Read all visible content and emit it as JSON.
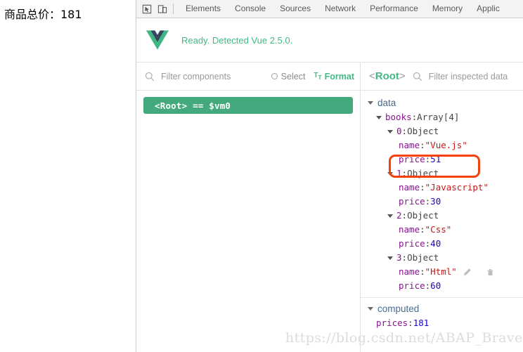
{
  "page": {
    "total_label": "商品总价：181"
  },
  "devtools": {
    "toolbar_icons": [
      "inspect-element-icon",
      "device-toolbar-icon"
    ],
    "tabs": [
      {
        "label": "Elements"
      },
      {
        "label": "Console"
      },
      {
        "label": "Sources"
      },
      {
        "label": "Network"
      },
      {
        "label": "Performance"
      },
      {
        "label": "Memory"
      },
      {
        "label": "Applic"
      }
    ],
    "banner": {
      "logo": "vue-logo",
      "status_text": "Ready. Detected Vue 2.5.0."
    },
    "tree_pane": {
      "filter_placeholder": "Filter components",
      "filter_value": "",
      "select_label": "Select",
      "format_label": "Format",
      "format_icon": "text-format-icon",
      "selected_node": "<Root> == $vm0"
    },
    "data_pane": {
      "root_tag_open": "<",
      "root_tag_name": "Root",
      "root_tag_close": ">",
      "filter_placeholder": "Filter inspected data",
      "filter_value": "",
      "sections": [
        {
          "name": "data",
          "rows": [
            {
              "indent": 1,
              "caret": true,
              "key": "books",
              "sep": ": ",
              "value": "Array[4]",
              "value_kind": "type"
            },
            {
              "indent": 2,
              "caret": true,
              "key": "0",
              "sep": ": ",
              "value": "Object",
              "value_kind": "type"
            },
            {
              "indent": 3,
              "caret": false,
              "key": "name",
              "sep": ": ",
              "value": "\"Vue.js\"",
              "value_kind": "string"
            },
            {
              "indent": 3,
              "caret": false,
              "key": "price",
              "sep": ": ",
              "value": "51",
              "value_kind": "number",
              "highlighted": true
            },
            {
              "indent": 2,
              "caret": true,
              "key": "1",
              "sep": ": ",
              "value": "Object",
              "value_kind": "type"
            },
            {
              "indent": 3,
              "caret": false,
              "key": "name",
              "sep": ": ",
              "value": "\"Javascript\"",
              "value_kind": "string"
            },
            {
              "indent": 3,
              "caret": false,
              "key": "price",
              "sep": ": ",
              "value": "30",
              "value_kind": "number"
            },
            {
              "indent": 2,
              "caret": true,
              "key": "2",
              "sep": ": ",
              "value": "Object",
              "value_kind": "type"
            },
            {
              "indent": 3,
              "caret": false,
              "key": "name",
              "sep": ": ",
              "value": "\"Css\"",
              "value_kind": "string"
            },
            {
              "indent": 3,
              "caret": false,
              "key": "price",
              "sep": ": ",
              "value": "40",
              "value_kind": "number"
            },
            {
              "indent": 2,
              "caret": true,
              "key": "3",
              "sep": ": ",
              "value": "Object",
              "value_kind": "type"
            },
            {
              "indent": 3,
              "caret": false,
              "key": "name",
              "sep": ": ",
              "value": "\"Html\"",
              "value_kind": "string",
              "icons": [
                "edit-pencil-icon",
                "delete-trash-icon"
              ]
            },
            {
              "indent": 3,
              "caret": false,
              "key": "price",
              "sep": ": ",
              "value": "60",
              "value_kind": "number"
            }
          ]
        },
        {
          "name": "computed",
          "rows": [
            {
              "indent": 1,
              "caret": false,
              "key": "prices",
              "sep": ": ",
              "value": "181",
              "value_kind": "number"
            }
          ]
        }
      ]
    }
  },
  "watermark": {
    "text": "https://blog.csdn.net/ABAP_Brave"
  },
  "colors": {
    "vue_green": "#42b983",
    "tree_selected_bg": "#44a97c",
    "annotation_red": "#f4400d",
    "key_purple": "#881391",
    "string_red": "#c41a16",
    "number_blue": "#1c00cf",
    "section_blue": "#486b8f"
  }
}
